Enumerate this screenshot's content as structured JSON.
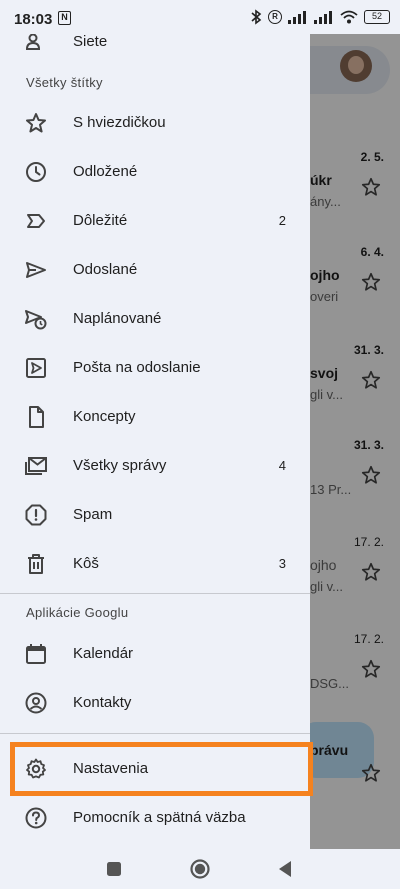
{
  "status_bar": {
    "time": "18:03",
    "battery": "52"
  },
  "drawer": {
    "top_item_label": "Siete",
    "section_all_labels": "Všetky štítky",
    "items": [
      {
        "label": "S hviezdičkou",
        "icon": "star-icon",
        "count": ""
      },
      {
        "label": "Odložené",
        "icon": "clock-icon",
        "count": ""
      },
      {
        "label": "Dôležité",
        "icon": "label-important-icon",
        "count": "2"
      },
      {
        "label": "Odoslané",
        "icon": "send-icon",
        "count": ""
      },
      {
        "label": "Naplánované",
        "icon": "schedule-send-icon",
        "count": ""
      },
      {
        "label": "Pošta na odoslanie",
        "icon": "outbox-icon",
        "count": ""
      },
      {
        "label": "Koncepty",
        "icon": "draft-icon",
        "count": ""
      },
      {
        "label": "Všetky správy",
        "icon": "all-mail-icon",
        "count": "4"
      },
      {
        "label": "Spam",
        "icon": "spam-icon",
        "count": ""
      },
      {
        "label": "Kôš",
        "icon": "trash-icon",
        "count": "3"
      }
    ],
    "section_google_apps": "Aplikácie Googlu",
    "apps": [
      {
        "label": "Kalendár",
        "icon": "calendar-icon"
      },
      {
        "label": "Kontakty",
        "icon": "contacts-icon"
      }
    ],
    "settings": {
      "label": "Nastavenia",
      "icon": "gear-icon"
    },
    "help": {
      "label": "Pomocník a spätná väzba",
      "icon": "help-icon"
    }
  },
  "background_list": {
    "rows": [
      {
        "date": "2. 5.",
        "subject": "úkr",
        "preview": "ány...",
        "bold": true
      },
      {
        "date": "6. 4.",
        "subject": "ojho",
        "preview": "overi",
        "bold": true
      },
      {
        "date": "31. 3.",
        "subject": "svoj",
        "preview": "gli v...",
        "bold": true
      },
      {
        "date": "31. 3.",
        "subject": "",
        "preview": "13 Pr...",
        "bold": true
      },
      {
        "date": "17. 2.",
        "subject": "ojho",
        "preview": "gli v...",
        "bold": false
      },
      {
        "date": "17. 2.",
        "subject": "",
        "preview": "DSG...",
        "bold": false
      }
    ],
    "compose_label": "právu"
  },
  "colors": {
    "drawer_bg": "#eef1f8",
    "highlight": "#f5821f",
    "compose_bg": "#c2e7ff"
  }
}
